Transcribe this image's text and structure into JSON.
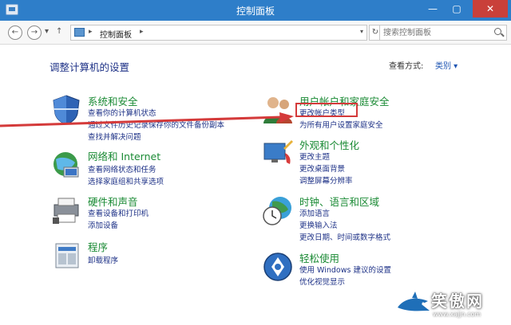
{
  "window": {
    "title": "控制面板"
  },
  "address": {
    "breadcrumb": "控制面板",
    "search_placeholder": "搜索控制面板"
  },
  "page": {
    "heading": "调整计算机的设置",
    "view_by_label": "查看方式:",
    "view_by_value": "类别 ▾"
  },
  "left_categories": [
    {
      "title": "系统和安全",
      "links": [
        "查看你的计算机状态",
        "通过文件历史记录保存你的文件备份副本",
        "查找并解决问题"
      ]
    },
    {
      "title": "网络和 Internet",
      "links": [
        "查看网络状态和任务",
        "选择家庭组和共享选项"
      ]
    },
    {
      "title": "硬件和声音",
      "links": [
        "查看设备和打印机",
        "添加设备"
      ]
    },
    {
      "title": "程序",
      "links": [
        "卸载程序"
      ]
    }
  ],
  "right_categories": [
    {
      "title": "用户帐户和家庭安全",
      "links": [
        "更改帐户类型",
        "为所有用户设置家庭安全"
      ]
    },
    {
      "title": "外观和个性化",
      "links": [
        "更改主题",
        "更改桌面背景",
        "调整屏幕分辨率"
      ]
    },
    {
      "title": "时钟、语言和区域",
      "links": [
        "添加语言",
        "更换输入法",
        "更改日期、时间或数字格式"
      ]
    },
    {
      "title": "轻松使用",
      "links": [
        "使用 Windows 建议的设置",
        "优化视觉显示"
      ]
    }
  ],
  "watermark": {
    "brand": "笑傲网",
    "site": "www.xajjn.com"
  },
  "colors": {
    "titlebar": "#2e7ec9",
    "link": "#1e3287",
    "category_title": "#1a8a34",
    "annotation": "#d43a3a"
  },
  "icons": {
    "system_security": "shield-icon",
    "network": "globe-network-icon",
    "hardware": "printer-icon",
    "programs": "programs-icon",
    "user_accounts": "users-icon",
    "appearance": "monitor-paint-icon",
    "clock_region": "clock-globe-icon",
    "ease_of_access": "ease-of-access-icon"
  }
}
